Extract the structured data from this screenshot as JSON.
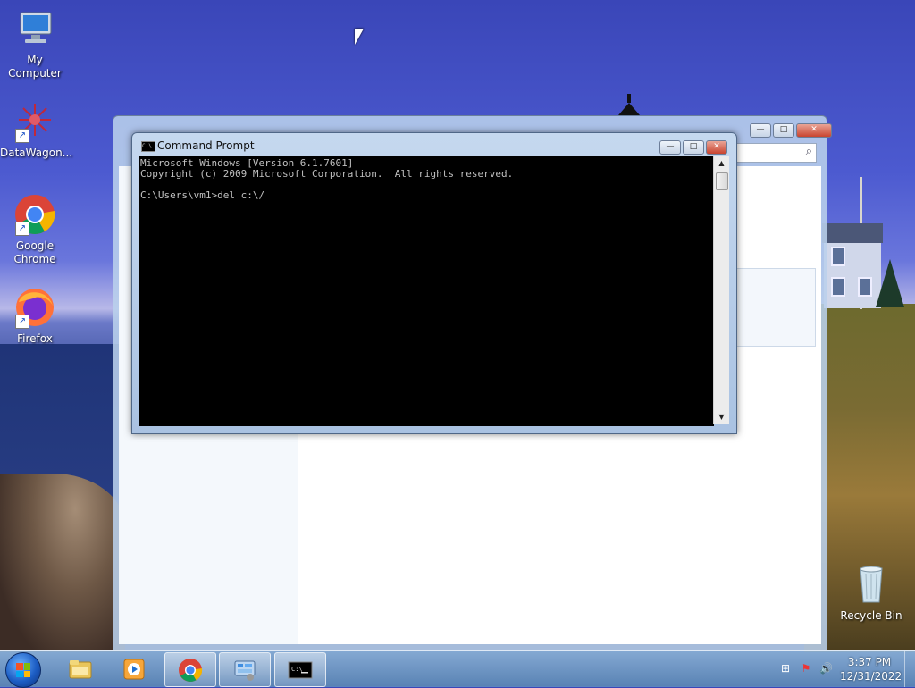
{
  "desktop": {
    "icons": [
      {
        "label": "My Computer"
      },
      {
        "label": "DataWagon..."
      },
      {
        "label": "Google Chrome"
      },
      {
        "label": "Firefox"
      },
      {
        "label": "Recycle Bin"
      }
    ]
  },
  "cmd_window": {
    "title": "Command Prompt",
    "lines": [
      "Microsoft Windows [Version 6.1.7601]",
      "Copyright (c) 2009 Microsoft Corporation.  All rights reserved.",
      "",
      "C:\\Users\\vm1>del c:\\/"
    ],
    "buttons": {
      "minimize": "—",
      "maximize": "□",
      "close": "✕"
    }
  },
  "bg_window": {
    "buttons": {
      "minimize": "—",
      "maximize": "□",
      "close": "✕"
    }
  },
  "taskbar": {
    "items": [
      "windows-explorer",
      "media-player",
      "google-chrome",
      "control-panel",
      "command-prompt"
    ],
    "clock": {
      "time": "3:37 PM",
      "date": "12/31/2022"
    }
  },
  "colors": {
    "console_bg": "#000000",
    "console_fg": "#c0c0c0",
    "close_red": "#c9442f"
  }
}
